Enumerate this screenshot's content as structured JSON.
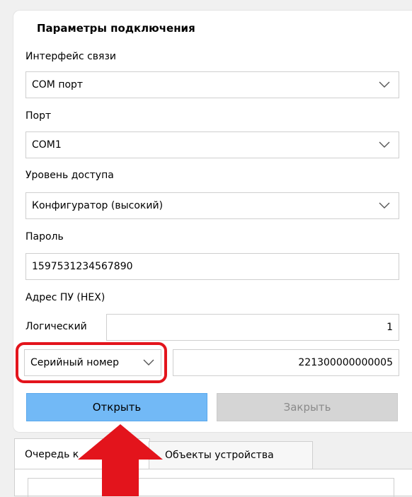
{
  "panel": {
    "title": "Параметры подключения",
    "interface_label": "Интерфейс связи",
    "interface_value": "COM порт",
    "port_label": "Порт",
    "port_value": "COM1",
    "access_label": "Уровень доступа",
    "access_value": "Конфигуратор (высокий)",
    "password_label": "Пароль",
    "password_value": "1597531234567890",
    "address_label": "Адрес ПУ (HEX)",
    "logical_label": "Логический",
    "logical_value": "1",
    "serial_mode": "Серийный номер",
    "serial_value": "221300000000005"
  },
  "buttons": {
    "open": "Открыть",
    "close": "Закрыть"
  },
  "tabs": [
    {
      "label": "Очередь к"
    },
    {
      "label": "Объекты устройства"
    }
  ],
  "annotation": {
    "highlight_color": "#e3141c",
    "arrow_color": "#e3141c",
    "arrow_target": "open-button"
  }
}
